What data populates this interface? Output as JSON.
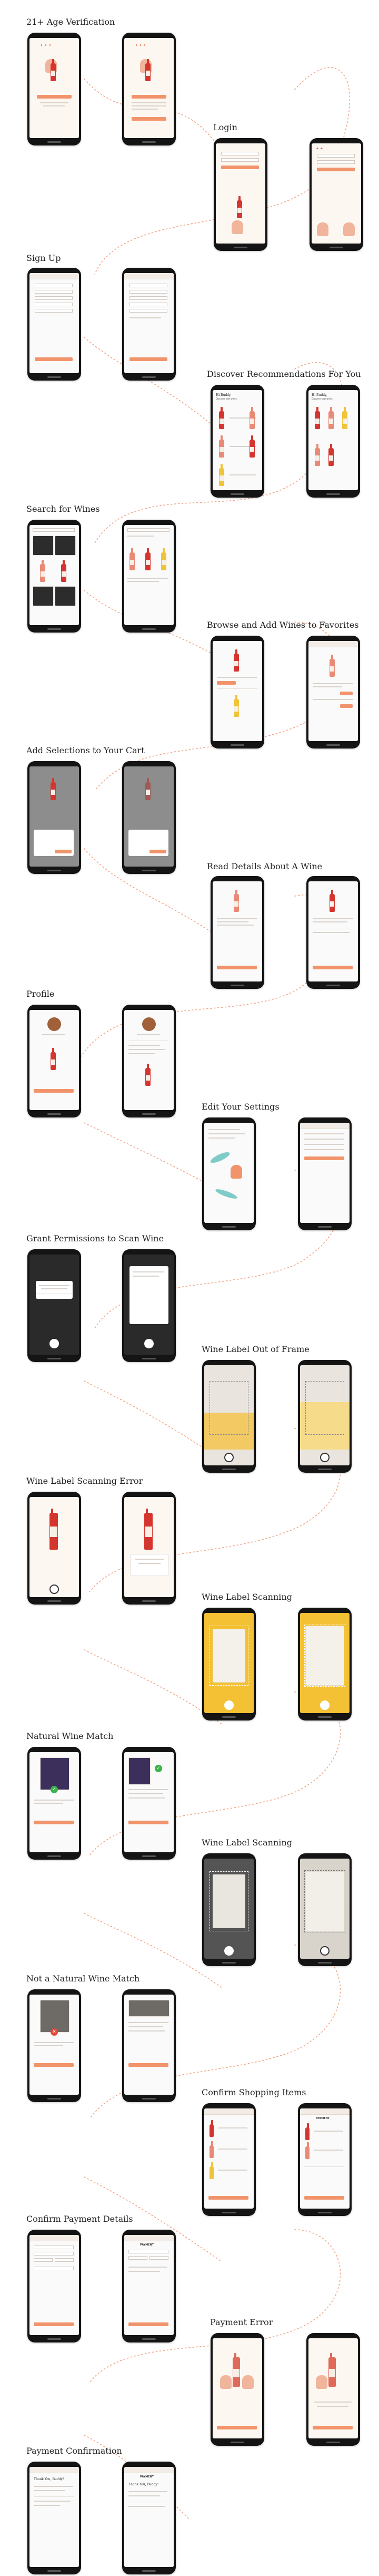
{
  "colors": {
    "accent": "#f2946b",
    "flow_dots": "#f2a383",
    "phone_frame": "#141414",
    "bottle_red": "#d4362f",
    "bottle_rose": "#e88a76",
    "bottle_yellow": "#f0c43a",
    "success_green": "#3bb34a",
    "error_red": "#e04a3c"
  },
  "sections": [
    {
      "title": "21+ Age Verification"
    },
    {
      "title": "Login"
    },
    {
      "title": "Sign Up"
    },
    {
      "title": "Discover Recommendations For You"
    },
    {
      "title": "Search for Wines"
    },
    {
      "title": "Browse and Add Wines to Favorites"
    },
    {
      "title": "Add Selections to Your Cart"
    },
    {
      "title": "Read Details About A Wine"
    },
    {
      "title": "Profile"
    },
    {
      "title": "Edit Your Settings"
    },
    {
      "title": "Grant Permissions to Scan Wine"
    },
    {
      "title": "Wine Label Out of Frame"
    },
    {
      "title": "Wine Label Scanning Error"
    },
    {
      "title": "Wine Label Scanning"
    },
    {
      "title": "Natural Wine Match"
    },
    {
      "title": "Wine Label Scanning"
    },
    {
      "title": "Not a Natural Wine Match"
    },
    {
      "title": "Confirm Shopping Items"
    },
    {
      "title": "Confirm Payment Details"
    },
    {
      "title": "Payment Error"
    },
    {
      "title": "Payment Confirmation"
    }
  ],
  "screens": {
    "hi_buddy": "Hi Buddy,",
    "discover": "Discover new wines",
    "payment": "PAYMENT",
    "thank_you": "Thank You, Buddy!"
  }
}
